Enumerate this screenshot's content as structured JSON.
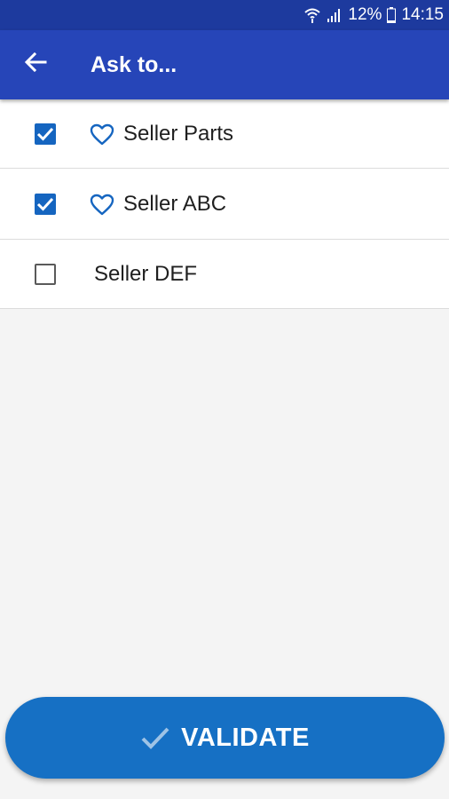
{
  "status_bar": {
    "battery_percent": "12%",
    "time": "14:15",
    "icons": [
      "wifi-icon",
      "signal-icon",
      "battery-icon"
    ]
  },
  "app_bar": {
    "back_icon": "arrow-left-icon",
    "title": "Ask to..."
  },
  "sellers": [
    {
      "name": "Seller Parts",
      "checked": true,
      "favorite": true
    },
    {
      "name": "Seller ABC",
      "checked": true,
      "favorite": true
    },
    {
      "name": "Seller DEF",
      "checked": false,
      "favorite": false
    }
  ],
  "validate_button": {
    "label": "VALIDATE",
    "icon": "checkmark-icon"
  },
  "colors": {
    "status_bar": "#1d3a9e",
    "app_bar": "#2645b8",
    "accent": "#1565c0",
    "button": "#1670c4",
    "background": "#f4f4f4",
    "check_icon": "#9ec3e6"
  }
}
